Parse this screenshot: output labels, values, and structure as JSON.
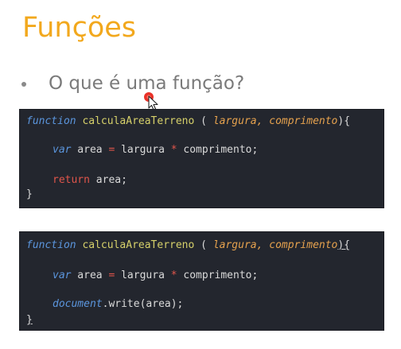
{
  "slide": {
    "title": "Funções",
    "bullet": "O que é uma função?"
  },
  "code_blocks": [
    {
      "line1": {
        "keyword": "function",
        "name": "calculaAreaTerreno",
        "open": " ( ",
        "param1": "largura",
        "comma": ", ",
        "param2": "comprimento",
        "close": "){"
      },
      "line2": {
        "keyword": "var",
        "lhs": " area ",
        "eq": "=",
        "mid": " largura ",
        "times": "*",
        "rhs": " comprimento;"
      },
      "line3": {
        "keyword": "return",
        "rest": " area;"
      },
      "line4": "}"
    },
    {
      "line1": {
        "keyword": "function",
        "name": "calculaAreaTerreno",
        "open": " ( ",
        "param1": "largura",
        "comma": ", ",
        "param2": "comprimento",
        "close": "){"
      },
      "line2": {
        "keyword": "var",
        "lhs": " area ",
        "eq": "=",
        "mid": " largura ",
        "times": "*",
        "rhs": " comprimento;"
      },
      "line3": {
        "object": "document",
        "rest": ".write(area);"
      },
      "line4": "}"
    }
  ],
  "colors": {
    "title": "#f2a81d",
    "code_background": "#23262e",
    "keyword": "#5b96de",
    "function_name": "#d6d06a",
    "parameter": "#e6a24e",
    "operator": "#e0554b"
  },
  "icons": {
    "cursor": "mouse-pointer-icon"
  }
}
